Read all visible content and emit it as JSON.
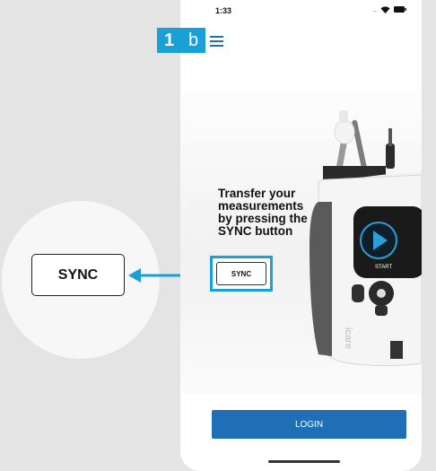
{
  "step": {
    "number": "1",
    "letter": "b"
  },
  "status_bar": {
    "time": "1:33",
    "signal_dots": "...."
  },
  "main": {
    "headline": "Transfer your measurements by pressing the SYNC button",
    "sync_label": "SYNC",
    "login_label": "LOGIN"
  },
  "magnifier": {
    "sync_label": "SYNC"
  },
  "device": {
    "brand": "icare",
    "start_label": "START"
  },
  "colors": {
    "accent": "#1aa0d8",
    "primary_button": "#1f6fb6",
    "background": "#e3e4e3"
  },
  "icons": [
    "menu-icon",
    "wifi-icon",
    "battery-icon",
    "arrow-left-icon",
    "play-icon"
  ]
}
